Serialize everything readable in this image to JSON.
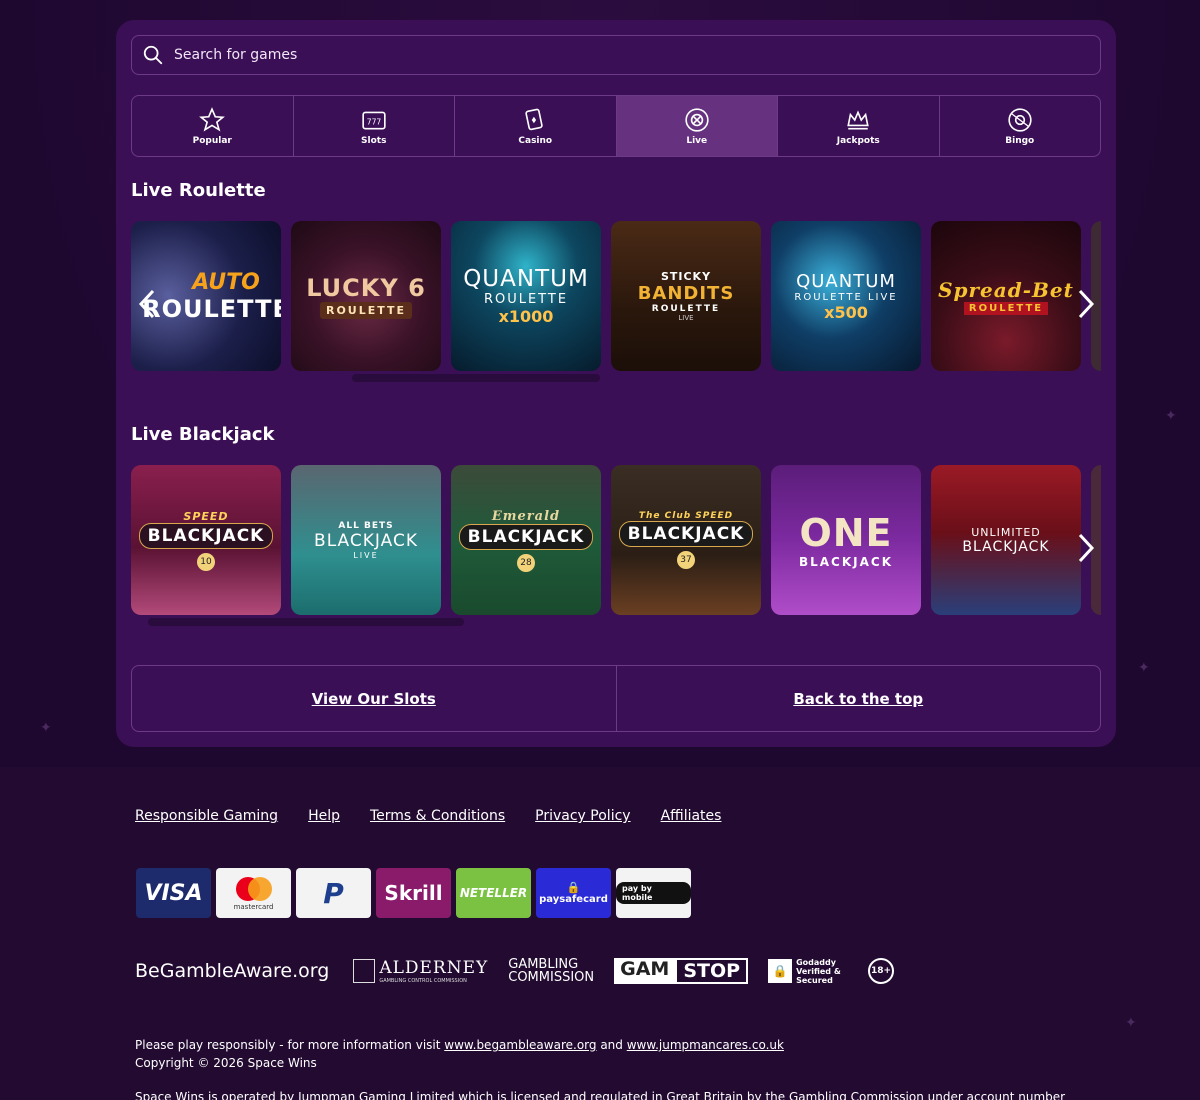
{
  "search": {
    "placeholder": "Search for games"
  },
  "tabs": [
    {
      "label": "Popular",
      "icon": "star-icon",
      "active": false
    },
    {
      "label": "Slots",
      "icon": "slot-machine-icon",
      "active": false
    },
    {
      "label": "Casino",
      "icon": "cards-icon",
      "active": false
    },
    {
      "label": "Live",
      "icon": "roulette-chip-icon",
      "active": true
    },
    {
      "label": "Jackpots",
      "icon": "crown-icon",
      "active": false
    },
    {
      "label": "Bingo",
      "icon": "bingo-ball-icon",
      "active": false
    }
  ],
  "sections": [
    {
      "title": "Live Roulette",
      "games": [
        {
          "line1": "AUTO",
          "line2": "ROULETTE",
          "line3": "",
          "line4": ""
        },
        {
          "line1": "",
          "line2": "LUCKY 6",
          "line3": "ROULETTE",
          "line4": ""
        },
        {
          "line1": "",
          "line2": "QUANTUM",
          "line3": "ROULETTE",
          "line4": "x1000"
        },
        {
          "line1": "STICKY",
          "line2": "BANDITS",
          "line3": "ROULETTE",
          "line4": "LIVE"
        },
        {
          "line1": "",
          "line2": "QUANTUM",
          "line3": "ROULETTE LIVE",
          "line4": "x500"
        },
        {
          "line1": "",
          "line2": "Spread-Bet",
          "line3": "ROULETTE",
          "line4": ""
        }
      ]
    },
    {
      "title": "Live Blackjack",
      "games": [
        {
          "line1": "SPEED",
          "line2": "BLACKJACK",
          "line3": "",
          "line4": "10"
        },
        {
          "line1": "ALL BETS",
          "line2": "BLACKJACK",
          "line3": "LIVE",
          "line4": ""
        },
        {
          "line1": "Emerald",
          "line2": "BLACKJACK",
          "line3": "",
          "line4": "28"
        },
        {
          "line1": "The Club SPEED",
          "line2": "BLACKJACK",
          "line3": "",
          "line4": "37"
        },
        {
          "line1": "",
          "line2": "ONE",
          "line3": "BLACKJACK",
          "line4": ""
        },
        {
          "line1": "UNLIMITED",
          "line2": "BLACKJACK",
          "line3": "",
          "line4": ""
        }
      ]
    }
  ],
  "buttons": {
    "view_slots": "View Our Slots",
    "back_top": "Back to the top"
  },
  "footer_links": [
    "Responsible Gaming",
    "Help",
    "Terms & Conditions",
    "Privacy Policy",
    "Affiliates"
  ],
  "payments": [
    "VISA",
    "mastercard",
    "P",
    "Skrill",
    "NETELLER",
    "paysafecard",
    "pay by mobile"
  ],
  "badges": {
    "begambleaware": "BeGambleAware.org",
    "alderney": "ALDERNEY",
    "alderney_sub": "GAMBLING CONTROL COMMISSION",
    "gambling_commission_1": "GAMBLING",
    "gambling_commission_2": "COMMISSION",
    "gamstop_1": "GAM",
    "gamstop_2": "STOP",
    "godaddy": "Godaddy Verified & Secured",
    "age": "18+"
  },
  "legal": {
    "line1_prefix": "Please play responsibly - for more information visit ",
    "link1": "www.begambleaware.org",
    "line1_mid": " and ",
    "link2": "www.jumpmancares.co.uk",
    "copyright": "Copyright © 2026 Space Wins",
    "operator": "Space Wins is operated by Jumpman Gaming Limited which is licensed and regulated in Great Britain by the Gambling Commission under account number"
  },
  "colors": {
    "panel": "#3b0f55",
    "active_tab": "#66317f",
    "border": "#6d3a8a",
    "page_bg": "#1e0830"
  }
}
